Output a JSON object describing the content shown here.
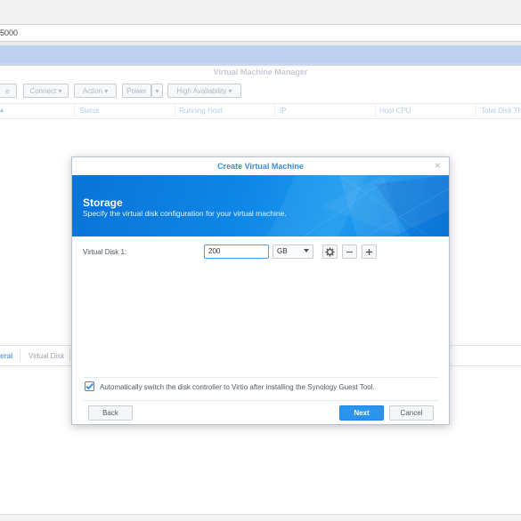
{
  "browser": {
    "address_fragment": "5000"
  },
  "app": {
    "title": "Virtual Machine Manager",
    "toolbar": {
      "create_fragment": "e",
      "connect": "Connect",
      "action": "Action",
      "power": "Power",
      "high_availability": "High Availability"
    },
    "table_columns": [
      "Status",
      "Running Host",
      "IP",
      "Host CPU",
      "Total Disk Th"
    ],
    "bottom_tabs": {
      "general_fragment": "eral",
      "virtual_disk": "Virtual Disk"
    }
  },
  "dialog": {
    "title": "Create Virtual Machine",
    "close_glyph": "×",
    "step_title": "Storage",
    "step_subtitle": "Specify the virtual disk configuration for your virtual machine.",
    "disk_label": "Virtual Disk 1:",
    "disk_size": "200",
    "disk_unit": "GB",
    "virtio_option": "Automatically switch the disk controller to Virtio after installing the Synology Guest Tool.",
    "virtio_checked": true,
    "back": "Back",
    "next": "Next",
    "cancel": "Cancel"
  },
  "colors": {
    "accent": "#2b94ec",
    "banner": "#0e87e6"
  },
  "icons": [
    "gear-icon",
    "minus-icon",
    "plus-icon",
    "checkmark-icon",
    "close-icon",
    "chevron-down-icon"
  ]
}
